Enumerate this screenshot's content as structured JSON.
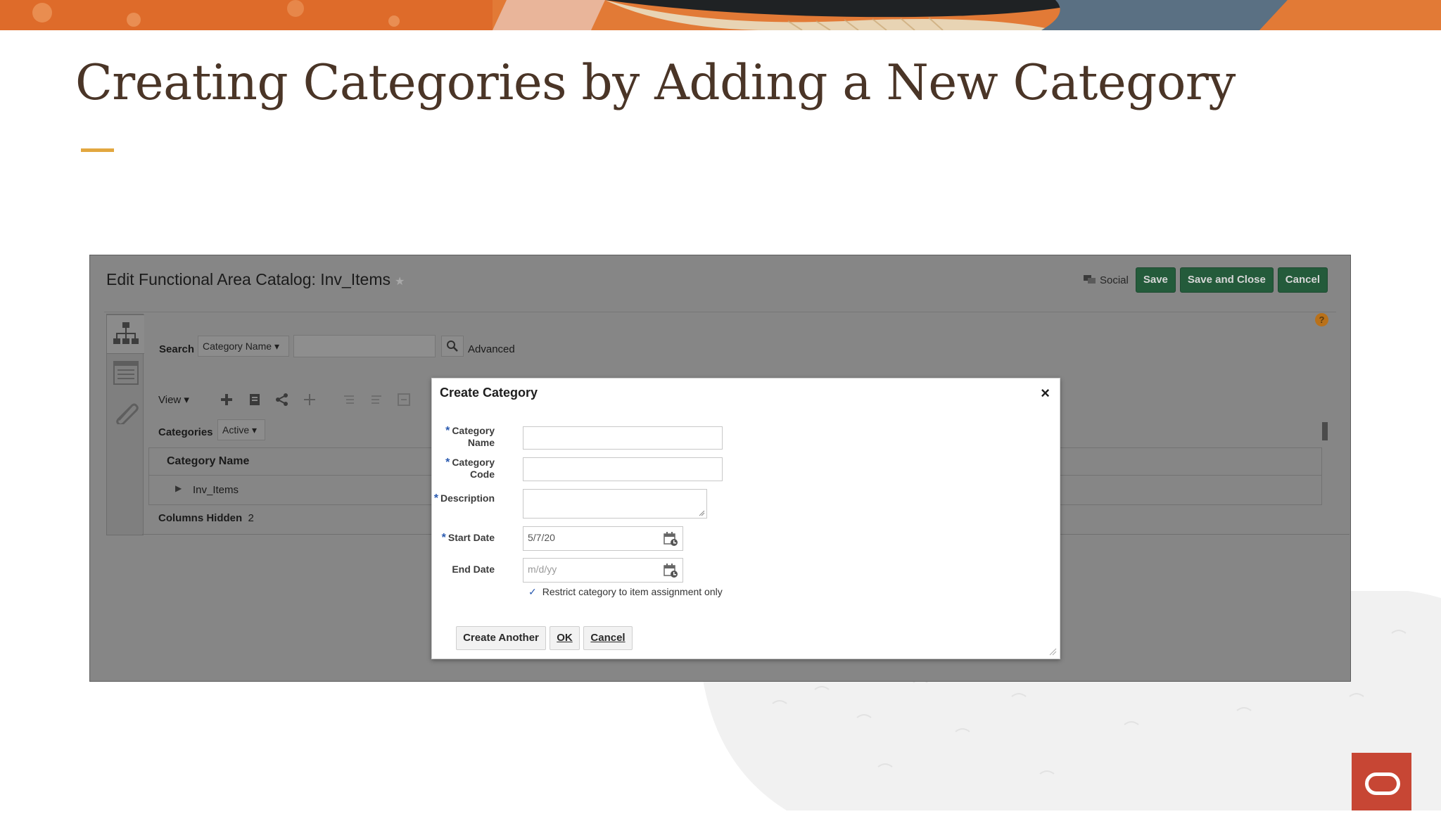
{
  "slide": {
    "title": "Creating Categories by Adding a New Category"
  },
  "app": {
    "page_title": "Edit Functional Area Catalog: Inv_Items",
    "social_label": "Social",
    "save_label": "Save",
    "save_close_label": "Save and Close",
    "cancel_label": "Cancel",
    "help_glyph": "?",
    "search": {
      "label": "Search",
      "field_select": "Category Name",
      "input_value": "",
      "advanced_label": "Advanced"
    },
    "view_label": "View",
    "categories_label": "Categories",
    "status_select": "Active",
    "table": {
      "header": "Category Name",
      "rows": [
        "Inv_Items"
      ]
    },
    "columns_hidden_label": "Columns Hidden",
    "columns_hidden_count": "2"
  },
  "dialog": {
    "title": "Create Category",
    "close_glyph": "×",
    "fields": {
      "category_name": {
        "label_line1": "Category",
        "label_line2": "Name",
        "value": ""
      },
      "category_code": {
        "label_line1": "Category",
        "label_line2": "Code",
        "value": ""
      },
      "description": {
        "label": "Description",
        "value": ""
      },
      "start_date": {
        "label": "Start Date",
        "value": "5/7/20"
      },
      "end_date": {
        "label": "End Date",
        "value": "",
        "placeholder": "m/d/yy"
      }
    },
    "restrict_checkbox": {
      "label": "Restrict category to item assignment only",
      "checked": true
    },
    "buttons": {
      "create_another": "Create Another",
      "ok": "OK",
      "cancel": "Cancel"
    }
  },
  "colors": {
    "title_brown": "#4a3527",
    "accent_gold": "#e2a740",
    "button_green": "#245b3b",
    "oracle_red": "#c74634",
    "required_blue": "#2a5ab0"
  }
}
